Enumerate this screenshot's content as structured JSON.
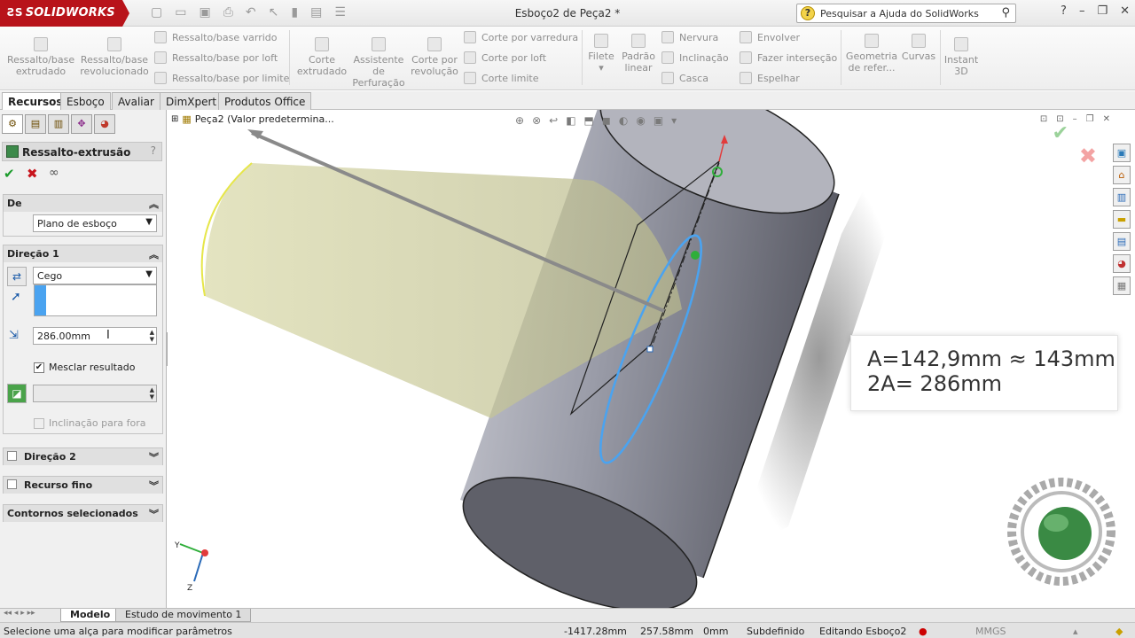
{
  "app": {
    "name": "SOLIDWORKS",
    "doc_title": "Esboço2 de Peça2 *"
  },
  "help": {
    "search_placeholder": "Pesquisar a Ajuda do SolidWorks"
  },
  "ribbon": {
    "extrude_boss": "Ressalto/base extrudado",
    "revolve_boss": "Ressalto/base revolucionado",
    "swept_boss": "Ressalto/base varrido",
    "loft_boss": "Ressalto/base por loft",
    "boundary_boss": "Ressalto/base por limite",
    "extruded_cut": "Corte extrudado",
    "hole_wizard": "Assistente de Perfuração",
    "revolved_cut": "Corte por revolução",
    "swept_cut": "Corte por varredura",
    "lofted_cut": "Corte por loft",
    "boundary_cut": "Corte limite",
    "fillet": "Filete",
    "linear_pattern": "Padrão linear",
    "rib": "Nervura",
    "draft": "Inclinação",
    "shell": "Casca",
    "wrap": "Envolver",
    "intersect": "Fazer interseção",
    "mirror": "Espelhar",
    "ref_geometry": "Geometria de refer...",
    "curves": "Curvas",
    "instant3d": "Instant 3D"
  },
  "tabs": [
    "Recursos",
    "Esboço",
    "Avaliar",
    "DimXpert",
    "Produtos Office"
  ],
  "property_manager": {
    "title": "Ressalto-extrusão",
    "from": {
      "header": "De",
      "value": "Plano de esboço"
    },
    "direction1": {
      "header": "Direção 1",
      "end_condition": "Cego",
      "depth": "286.00mm",
      "merge_label": "Mesclar resultado",
      "merge_checked": true,
      "draft_label": "Inclinação para fora"
    },
    "direction2": {
      "header": "Direção 2"
    },
    "thin_feature": {
      "header": "Recurso fino"
    },
    "selected_contours": {
      "header": "Contornos selecionados"
    }
  },
  "viewport": {
    "tree_item": "Peça2  (Valor predetermina...",
    "info_line1": "A=142,9mm ≈ 143mm",
    "info_line2": "2A= 286mm"
  },
  "bottom_tabs": [
    "Modelo",
    "Estudo de movimento 1"
  ],
  "status": {
    "message": "Selecione uma alça para modificar parâmetros",
    "x": "-1417.28mm",
    "y": "257.58mm",
    "z": "0mm",
    "definition": "Subdefinido",
    "editing": "Editando Esboço2",
    "units": "MMGS"
  },
  "colors": {
    "brand": "#b8131a",
    "selection": "#4aa3f0",
    "ok": "#1a9b2a",
    "cancel": "#c8141c"
  }
}
